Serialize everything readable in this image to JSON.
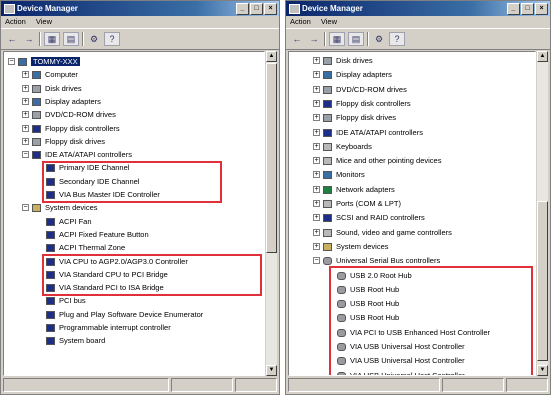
{
  "window1": {
    "title": "Device Manager",
    "menu": [
      "Action",
      "View"
    ],
    "tree": [
      {
        "label": "TOMMY-XXX",
        "level": 0,
        "icon": "computer-icon",
        "selected": true
      },
      {
        "label": "Computer",
        "level": 1,
        "icon": "monitor-icon"
      },
      {
        "label": "Disk drives",
        "level": 1,
        "icon": "disk-icon"
      },
      {
        "label": "Display adapters",
        "level": 1,
        "icon": "monitor-icon"
      },
      {
        "label": "DVD/CD-ROM drives",
        "level": 1,
        "icon": "disk-icon"
      },
      {
        "label": "Floppy disk controllers",
        "level": 1,
        "icon": "chip-icon"
      },
      {
        "label": "Floppy disk drives",
        "level": 1,
        "icon": "disk-icon"
      },
      {
        "label": "IDE ATA/ATAPI controllers",
        "level": 1,
        "icon": "chip-icon",
        "expanded": true
      },
      {
        "label": "Primary IDE Channel",
        "level": 2,
        "icon": "chip-icon"
      },
      {
        "label": "Secondary IDE Channel",
        "level": 2,
        "icon": "chip-icon"
      },
      {
        "label": "VIA Bus Master IDE Controller",
        "level": 2,
        "icon": "chip-icon"
      },
      {
        "label": "System devices",
        "level": 1,
        "icon": "folder-icon",
        "expanded": true
      },
      {
        "label": "ACPI Fan",
        "level": 2,
        "icon": "chip-icon"
      },
      {
        "label": "ACPI Fixed Feature Button",
        "level": 2,
        "icon": "chip-icon"
      },
      {
        "label": "ACPI Thermal Zone",
        "level": 2,
        "icon": "chip-icon"
      },
      {
        "label": "VIA CPU to AGP2.0/AGP3.0 Controller",
        "level": 2,
        "icon": "chip-icon"
      },
      {
        "label": "VIA Standard CPU to PCI Bridge",
        "level": 2,
        "icon": "chip-icon"
      },
      {
        "label": "VIA Standard PCI to ISA Bridge",
        "level": 2,
        "icon": "chip-icon"
      },
      {
        "label": "PCI bus",
        "level": 2,
        "icon": "chip-icon"
      },
      {
        "label": "Plug and Play Software Device Enumerator",
        "level": 2,
        "icon": "chip-icon"
      },
      {
        "label": "Programmable interrupt controller",
        "level": 2,
        "icon": "chip-icon"
      },
      {
        "label": "System board",
        "level": 2,
        "icon": "chip-icon"
      }
    ]
  },
  "window2": {
    "title": "Device Manager",
    "menu": [
      "Action",
      "View"
    ],
    "tree": [
      {
        "label": "Disk drives",
        "level": 1,
        "icon": "disk-icon"
      },
      {
        "label": "Display adapters",
        "level": 1,
        "icon": "monitor-icon"
      },
      {
        "label": "DVD/CD-ROM drives",
        "level": 1,
        "icon": "disk-icon"
      },
      {
        "label": "Floppy disk controllers",
        "level": 1,
        "icon": "chip-icon"
      },
      {
        "label": "Floppy disk drives",
        "level": 1,
        "icon": "disk-icon"
      },
      {
        "label": "IDE ATA/ATAPI controllers",
        "level": 1,
        "icon": "chip-icon"
      },
      {
        "label": "Keyboards",
        "level": 1,
        "icon": "keyboard-icon"
      },
      {
        "label": "Mice and other pointing devices",
        "level": 1,
        "icon": "mouse-icon"
      },
      {
        "label": "Monitors",
        "level": 1,
        "icon": "monitor-icon"
      },
      {
        "label": "Network adapters",
        "level": 1,
        "icon": "network-icon"
      },
      {
        "label": "Ports (COM & LPT)",
        "level": 1,
        "icon": "port-icon"
      },
      {
        "label": "SCSI and RAID controllers",
        "level": 1,
        "icon": "chip-icon"
      },
      {
        "label": "Sound, video and game controllers",
        "level": 1,
        "icon": "sound-icon"
      },
      {
        "label": "System devices",
        "level": 1,
        "icon": "folder-icon"
      },
      {
        "label": "Universal Serial Bus controllers",
        "level": 1,
        "icon": "usb-icon",
        "expanded": true
      },
      {
        "label": "USB 2.0 Root Hub",
        "level": 2,
        "icon": "usb-icon"
      },
      {
        "label": "USB Root Hub",
        "level": 2,
        "icon": "usb-icon"
      },
      {
        "label": "USB Root Hub",
        "level": 2,
        "icon": "usb-icon"
      },
      {
        "label": "USB Root Hub",
        "level": 2,
        "icon": "usb-icon"
      },
      {
        "label": "VIA PCI to USB Enhanced Host Controller",
        "level": 2,
        "icon": "usb-icon"
      },
      {
        "label": "VIA USB Universal Host Controller",
        "level": 2,
        "icon": "usb-icon"
      },
      {
        "label": "VIA USB Universal Host Controller",
        "level": 2,
        "icon": "usb-icon"
      },
      {
        "label": "VIA USB Universal Host Controller",
        "level": 2,
        "icon": "usb-icon"
      }
    ]
  },
  "colors": {
    "highlight": "#e0303a",
    "selection": "#0a246a",
    "titlebar": "#0a246a"
  }
}
